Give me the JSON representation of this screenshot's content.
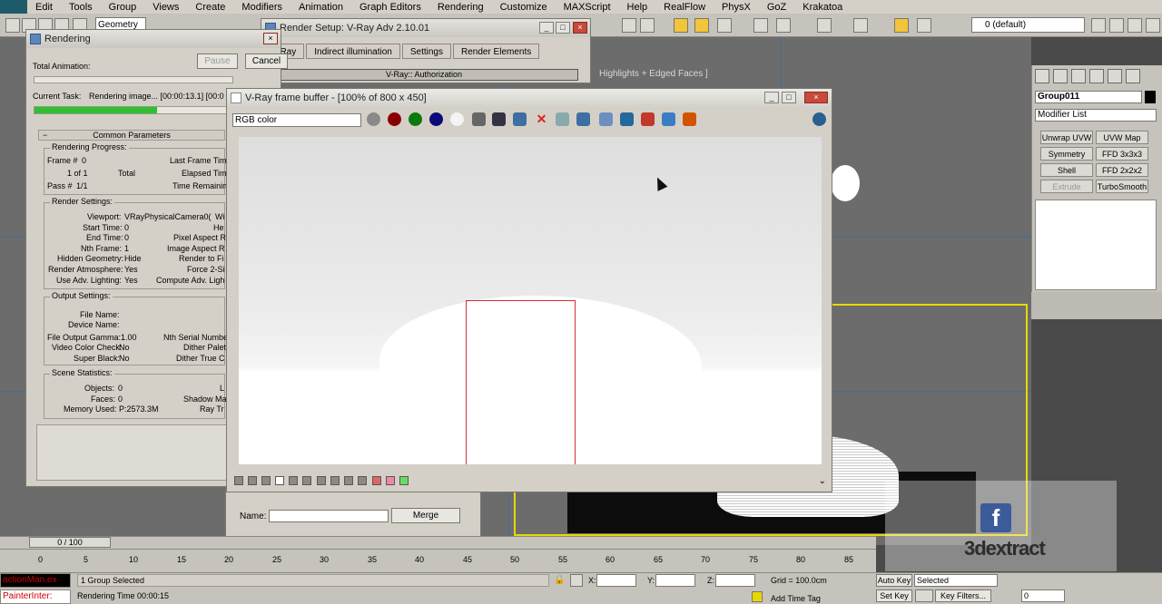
{
  "menubar": {
    "items": [
      "Edit",
      "Tools",
      "Group",
      "Views",
      "Create",
      "Modifiers",
      "Animation",
      "Graph Editors",
      "Rendering",
      "Customize",
      "MAXScript",
      "Help",
      "RealFlow",
      "PhysX",
      "GoZ",
      "Krakatoa"
    ]
  },
  "toolbar": {
    "geometry_select": "Geometry",
    "layer_select": "0 (default)"
  },
  "viewport": {
    "label": "Highlights + Edged Faces ]"
  },
  "command_panel": {
    "object_name": "Group011",
    "modifier_list": "Modifier List",
    "buttons": [
      "Unwrap UVW",
      "UVW Map",
      "Symmetry",
      "FFD 3x3x3",
      "Shell",
      "FFD 2x2x2",
      "Extrude",
      "TurboSmooth"
    ],
    "object_color": "#000000"
  },
  "rendering_dialog": {
    "title": "Rendering",
    "pause_label": "Pause",
    "cancel_label": "Cancel",
    "total_animation_label": "Total Animation:",
    "current_task_label": "Current Task:",
    "current_task_value": "Rendering image... [00:00:13.1] [00:0",
    "progress": 0.62,
    "common_parameters": "Common Parameters",
    "render_progress_title": "Rendering Progress:",
    "frame_label": "Frame #",
    "frame_value": "0",
    "last_frame_time": "Last Frame Tim",
    "of_label": "1 of 1",
    "total_label": "Total",
    "elapsed_time": "Elapsed Tim",
    "pass_label": "Pass #",
    "pass_value": "1/1",
    "time_remaining": "Time Remainin",
    "render_settings_title": "Render Settings:",
    "viewport_label": "Viewport:",
    "viewport_value": "VRayPhysicalCamera0(",
    "viewport_right": "Wi",
    "start_time": "Start Time:",
    "start_time_value": "0",
    "start_right": "He",
    "end_time": "End Time:",
    "end_time_value": "0",
    "pixel_aspect": "Pixel Aspect R",
    "nth_frame": "Nth Frame:",
    "nth_frame_value": "1",
    "image_aspect": "Image Aspect R",
    "hidden_geometry": "Hidden Geometry:",
    "hidden_geometry_value": "Hide",
    "render_to_file": "Render to Fi",
    "render_atmosphere": "Render Atmosphere:",
    "render_atmosphere_value": "Yes",
    "force_2sided": "Force 2-Si",
    "use_adv_lighting": "Use Adv. Lighting:",
    "use_adv_lighting_value": "Yes",
    "compute_adv": "Compute Adv. Ligh",
    "output_settings_title": "Output Settings:",
    "file_name": "File Name:",
    "device_name": "Device Name:",
    "file_output_gamma": "File Output Gamma:",
    "file_output_gamma_value": "1.00",
    "nth_serial": "Nth Serial Number",
    "video_color_check": "Video Color Check:",
    "video_color_check_value": "No",
    "dither_paletted": "Dither Palet",
    "super_black": "Super Black:",
    "super_black_value": "No",
    "dither_true": "Dither True C",
    "scene_statistics_title": "Scene Statistics:",
    "objects": "Objects:",
    "objects_value": "0",
    "objects_right": "L",
    "faces": "Faces:",
    "faces_value": "0",
    "shadow_map": "Shadow Ma",
    "memory_used": "Memory Used: P:2573.3M",
    "ray_tr": "Ray Tr"
  },
  "render_setup": {
    "title": "Render Setup: V-Ray Adv 2.10.01",
    "tabs": [
      "V-Ray",
      "Indirect illumination",
      "Settings",
      "Render Elements"
    ],
    "rollout": "V-Ray:: Authorization",
    "name_label": "Name:",
    "merge_label": "Merge"
  },
  "vfb": {
    "title": "V-Ray frame buffer - [100% of 800 x 450]",
    "channel": "RGB color",
    "channel_colors": [
      "#8a8a8a",
      "#8a0000",
      "#0a7a0a",
      "#0a0a7a",
      "#f4f4f4"
    ]
  },
  "time_slider": {
    "position": "0 / 100",
    "ticks": [
      "0",
      "5",
      "10",
      "15",
      "20",
      "25",
      "30",
      "35",
      "40",
      "45",
      "50",
      "55",
      "60",
      "65",
      "70",
      "75",
      "80",
      "85"
    ]
  },
  "status": {
    "maxscript_top": "actionMan.ex",
    "maxscript_bottom": "PainterInter:",
    "selection": "1 Group Selected",
    "render_time": "Rendering Time 00:00:15",
    "x_label": "X:",
    "y_label": "Y:",
    "z_label": "Z:",
    "grid": "Grid = 100.0cm",
    "add_time_tag": "Add Time Tag",
    "auto_key": "Auto Key",
    "selected": "Selected",
    "set_key": "Set Key",
    "key_filters": "Key Filters...",
    "frame_field": "0"
  },
  "watermark": {
    "text": "3dextract",
    "fb": "f"
  }
}
